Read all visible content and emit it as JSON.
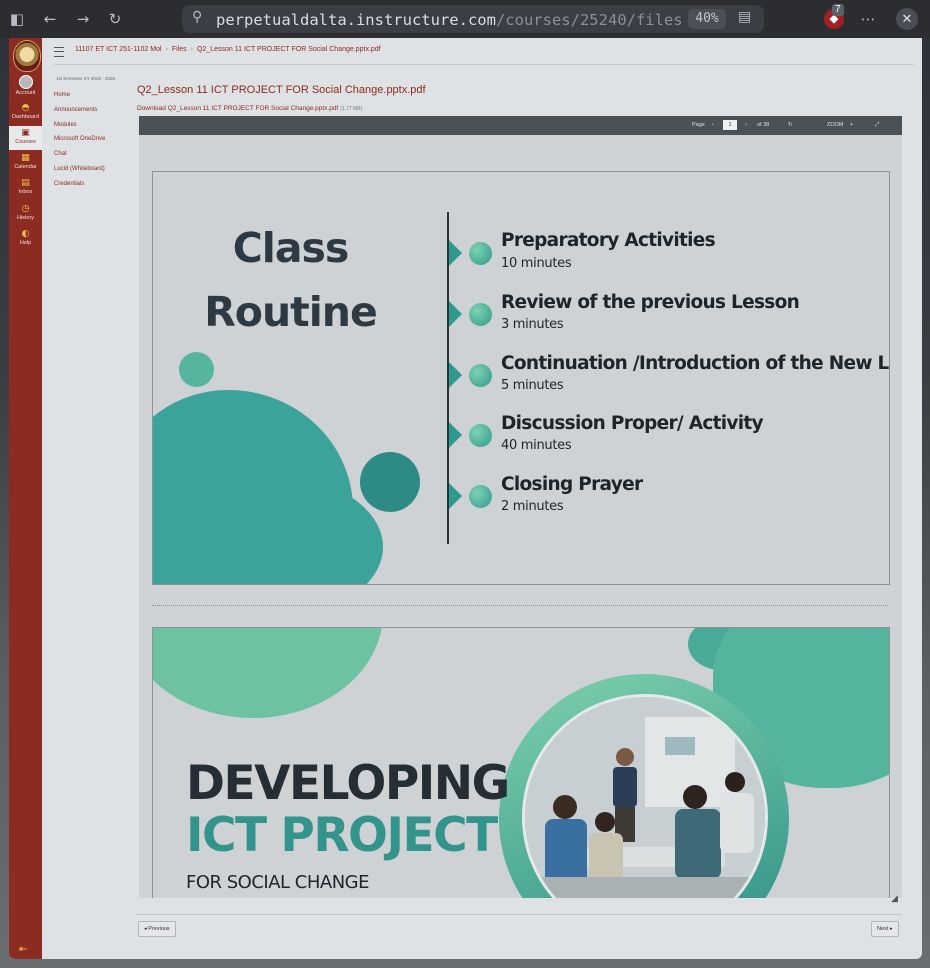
{
  "browser": {
    "url_host": "perpetualdalta.instructure.com",
    "url_path": "/courses/25240/files",
    "zoom": "40%",
    "extension_badge": "7"
  },
  "global_nav": {
    "items": [
      {
        "label": "Account"
      },
      {
        "label": "Dashboard"
      },
      {
        "label": "Courses"
      },
      {
        "label": "Calendar"
      },
      {
        "label": "Inbox"
      },
      {
        "label": "History"
      },
      {
        "label": "Help"
      }
    ]
  },
  "breadcrumbs": {
    "course": "11107 ET ICT 251-1102 Mol",
    "files": "Files",
    "file": "Q2_Lesson 11 ICT PROJECT FOR Social Change.pptx.pdf"
  },
  "course_nav": {
    "term": "1st Semester SY 2025 - 2026",
    "items": [
      "Home",
      "Announcements",
      "Modules",
      "Microsoft OneDrive",
      "Chat",
      "Lucid (Whiteboard)",
      "Credentials"
    ]
  },
  "file": {
    "title": "Q2_Lesson 11 ICT PROJECT FOR Social Change.pptx.pdf",
    "download_label": "Download Q2_Lesson 11 ICT PROJECT FOR Social Change.pptx.pdf",
    "size": "(1.77 MB)"
  },
  "viewer": {
    "page_label": "Page",
    "current_page": "1",
    "of_pages": "of 38",
    "zoom_label": "ZOOM"
  },
  "slide1": {
    "title_line1": "Class",
    "title_line2": "Routine",
    "items": [
      {
        "title": "Preparatory Activities",
        "duration": "10 minutes"
      },
      {
        "title": "Review of the previous Lesson",
        "duration": "3 minutes"
      },
      {
        "title": "Continuation /Introduction of the New Lesson",
        "duration": "5 minutes"
      },
      {
        "title": "Discussion Proper/ Activity",
        "duration": "40 minutes"
      },
      {
        "title": "Closing Prayer",
        "duration": "2 minutes"
      }
    ]
  },
  "slide2": {
    "line1": "DEVELOPING",
    "line2": "ICT PROJECT",
    "line3": "FOR SOCIAL CHANGE"
  },
  "pager": {
    "previous": "◂ Previous",
    "next": "Next ▸"
  },
  "colors": {
    "brand": "#8b2b22",
    "accent_teal": "#33948b",
    "icon_gold": "#f0c74a"
  }
}
